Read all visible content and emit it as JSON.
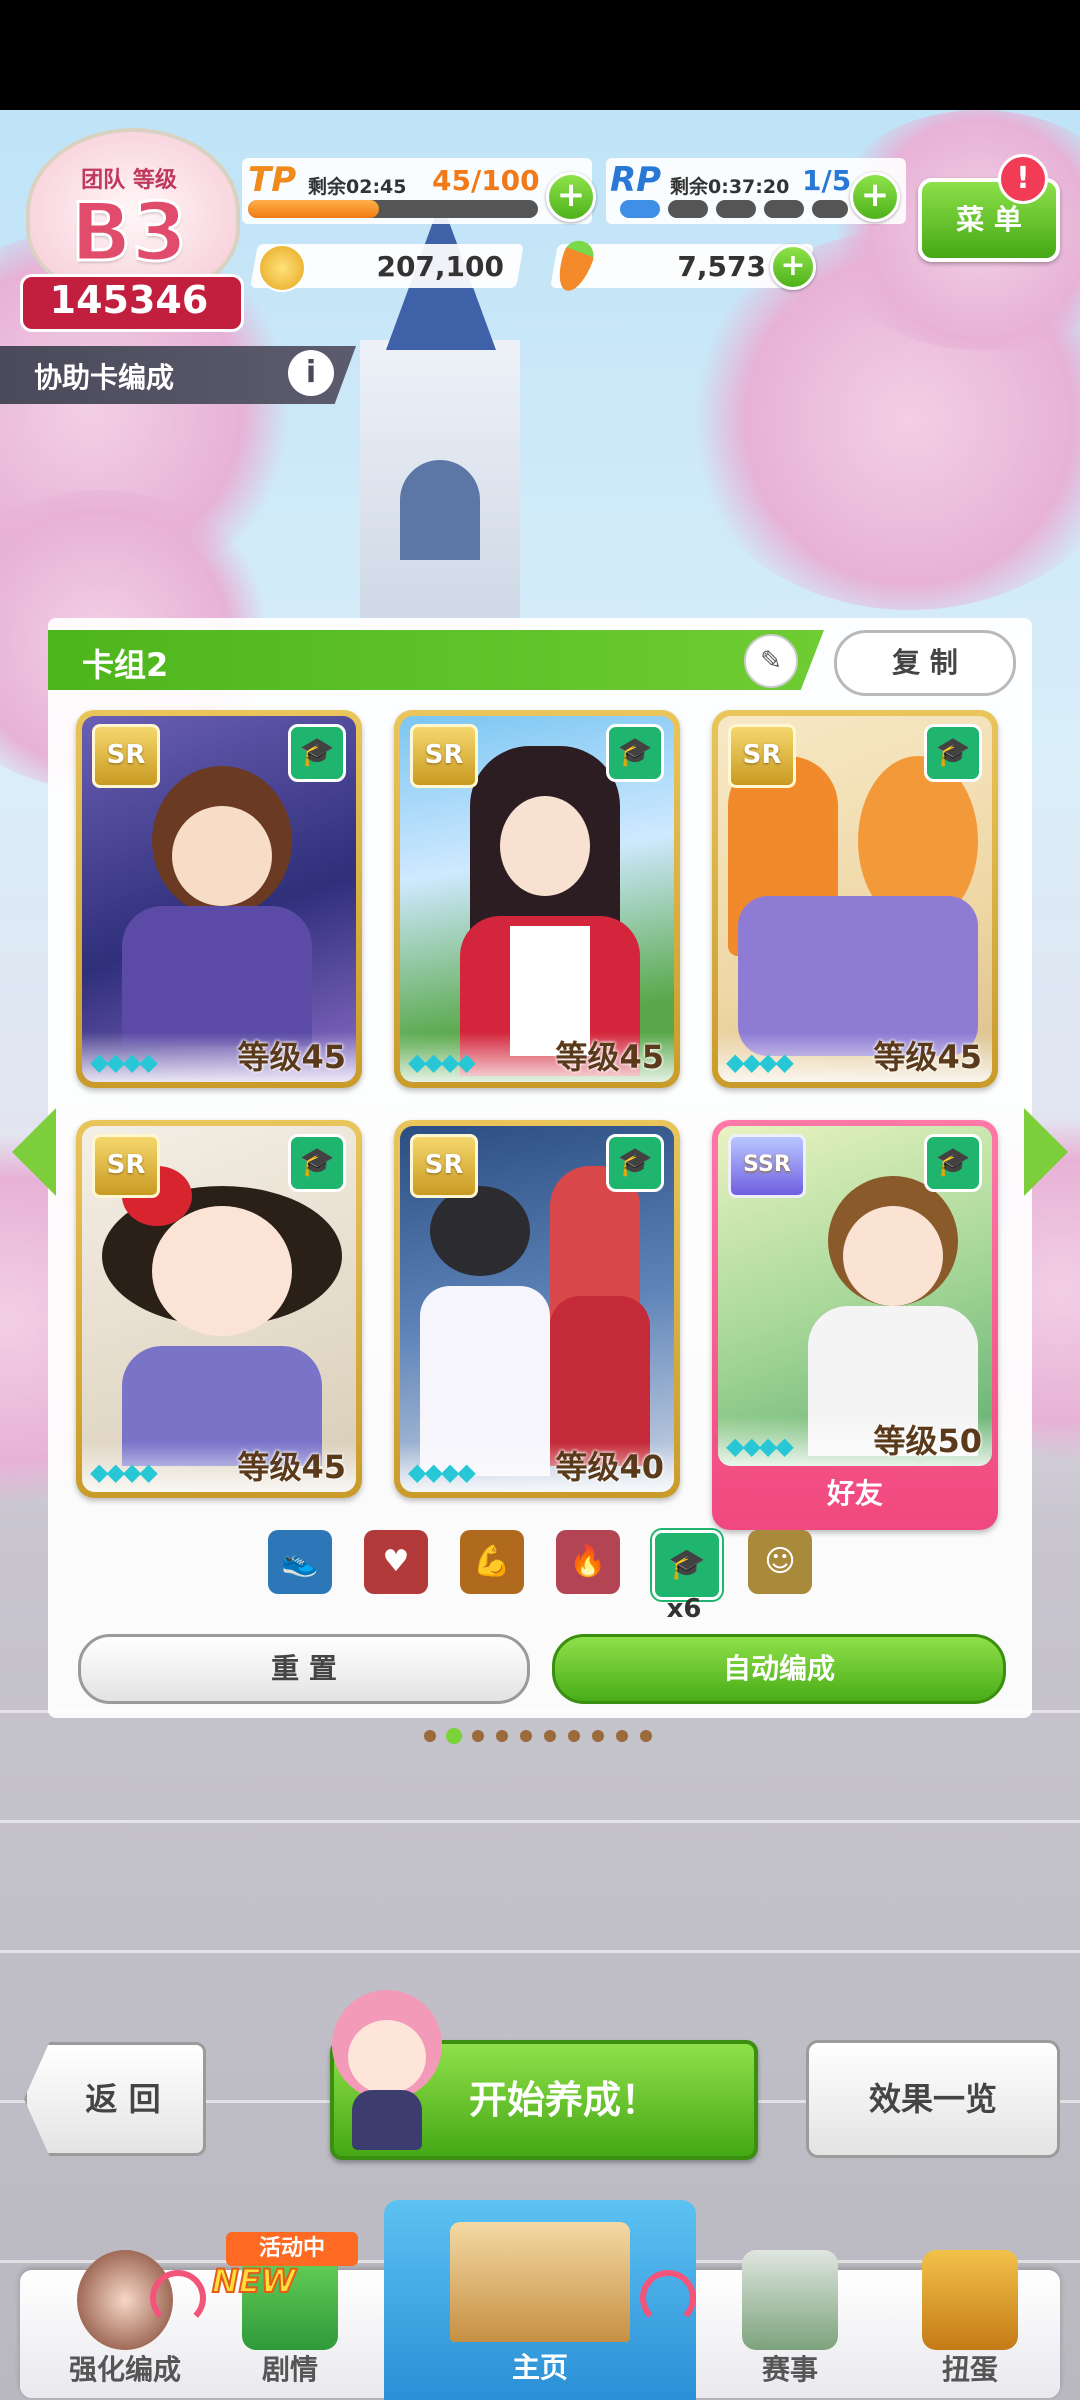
{
  "team": {
    "label": "团队 等级",
    "rank": "B3",
    "score": "145346"
  },
  "tp": {
    "label": "TP",
    "timer": "剩余02:45",
    "value": "45/100"
  },
  "rp": {
    "label": "RP",
    "timer": "剩余0:37:20",
    "value": "1/5"
  },
  "currency": {
    "coins": "207,100",
    "carrots": "7,573"
  },
  "menu": {
    "label": "菜 单",
    "alert": "!"
  },
  "section": {
    "title": "协助卡编成",
    "info": "i"
  },
  "deck": {
    "name": "卡组2",
    "copy_label": "复 制",
    "cards": [
      {
        "rarity": "SR",
        "level": "等级45"
      },
      {
        "rarity": "SR",
        "level": "等级45"
      },
      {
        "rarity": "SR",
        "level": "等级45"
      },
      {
        "rarity": "SR",
        "level": "等级45"
      },
      {
        "rarity": "SR",
        "level": "等级40"
      },
      {
        "rarity": "SSR",
        "level": "等级50",
        "tag": "好友"
      }
    ],
    "wisdom_count": "x6",
    "reset_label": "重 置",
    "auto_label": "自动编成"
  },
  "actions": {
    "back": "返 回",
    "start": "开始养成！",
    "effects": "效果一览"
  },
  "nav": {
    "tabs": [
      "强化编成",
      "剧情",
      "主页",
      "赛事",
      "扭蛋"
    ],
    "event_badge": "活动中",
    "new_badge": "NEW"
  },
  "colors": {
    "accent_green": "#4db51c",
    "friend_pink": "#f25a93",
    "gold": "#d4a530"
  }
}
